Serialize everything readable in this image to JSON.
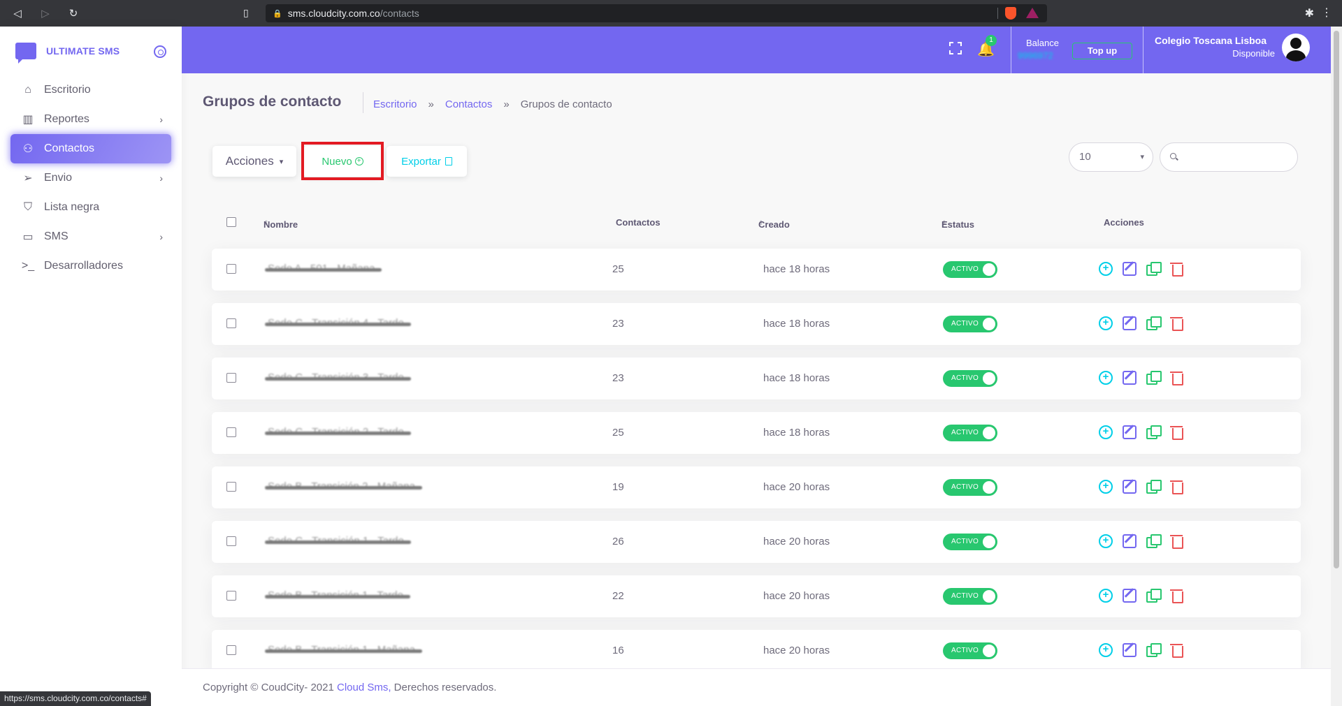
{
  "browser": {
    "host": "sms.cloudcity.com.co",
    "path": "/contacts",
    "status_url": "https://sms.cloudcity.com.co/contacts#"
  },
  "brand": {
    "name": "ULTIMATE SMS",
    "color": "#7367f0"
  },
  "sidebar": {
    "items": [
      {
        "label": "Escritorio",
        "icon": "home-icon",
        "has_children": false,
        "active": false
      },
      {
        "label": "Reportes",
        "icon": "bar-chart-icon",
        "has_children": true,
        "active": false
      },
      {
        "label": "Contactos",
        "icon": "user-icon",
        "has_children": false,
        "active": true
      },
      {
        "label": "Envio",
        "icon": "send-icon",
        "has_children": true,
        "active": false
      },
      {
        "label": "Lista negra",
        "icon": "shield-icon",
        "has_children": false,
        "active": false
      },
      {
        "label": "SMS",
        "icon": "message-icon",
        "has_children": true,
        "active": false
      },
      {
        "label": "Desarrolladores",
        "icon": "terminal-icon",
        "has_children": false,
        "active": false
      }
    ]
  },
  "header": {
    "notification_count": "1",
    "balance_label": "Balance",
    "balance_value": "9996972",
    "topup_label": "Top up",
    "user_name": "Colegio Toscana Lisboa",
    "user_status": "Disponible"
  },
  "page": {
    "title": "Grupos de contacto",
    "breadcrumb": [
      "Escritorio",
      "Contactos",
      "Grupos de contacto"
    ]
  },
  "toolbar": {
    "actions_label": "Acciones",
    "new_label": "Nuevo",
    "export_label": "Exportar",
    "per_page": "10",
    "search_placeholder": ""
  },
  "table": {
    "columns": [
      "Nombre",
      "Contactos",
      "Creado",
      "Estatus",
      "Acciones"
    ],
    "rows": [
      {
        "name": "Sede A - 501 - Mañana",
        "contacts": "25",
        "created": "hace 18 horas",
        "status": "ACTIVO"
      },
      {
        "name": "Sede C - Transición 4 - Tarde",
        "contacts": "23",
        "created": "hace 18 horas",
        "status": "ACTIVO"
      },
      {
        "name": "Sede C - Transición 3 - Tarde",
        "contacts": "23",
        "created": "hace 18 horas",
        "status": "ACTIVO"
      },
      {
        "name": "Sede C - Transición 2 - Tarde",
        "contacts": "25",
        "created": "hace 18 horas",
        "status": "ACTIVO"
      },
      {
        "name": "Sede B - Transición 2 - Mañana",
        "contacts": "19",
        "created": "hace 20 horas",
        "status": "ACTIVO"
      },
      {
        "name": "Sede C - Transición 1 - Tarde",
        "contacts": "26",
        "created": "hace 20 horas",
        "status": "ACTIVO"
      },
      {
        "name": "Sede B - Transición 1 - Tarde",
        "contacts": "22",
        "created": "hace 20 horas",
        "status": "ACTIVO"
      },
      {
        "name": "Sede B - Transición 1 - Mañana",
        "contacts": "16",
        "created": "hace 20 horas",
        "status": "ACTIVO"
      }
    ]
  },
  "footer": {
    "copyright": "Copyright © CoudCity- 2021 ",
    "link": "Cloud Sms,",
    "rights": " Derechos reservados."
  },
  "colors": {
    "primary": "#7367f0",
    "success": "#28c76f",
    "info": "#00cfe8",
    "danger": "#ea5455",
    "highlight": "#e31b23"
  }
}
